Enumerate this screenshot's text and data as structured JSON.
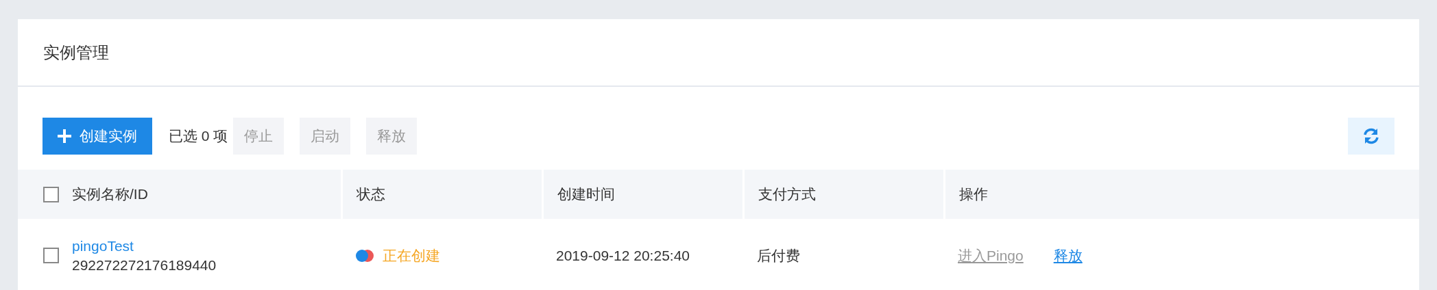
{
  "panel": {
    "title": "实例管理"
  },
  "toolbar": {
    "create_button": "创建实例",
    "selection_text": "已选 0 项",
    "batch_buttons": [
      {
        "label": "停止",
        "disabled": true
      },
      {
        "label": "启动",
        "disabled": true
      },
      {
        "label": "释放",
        "disabled": true
      }
    ]
  },
  "table": {
    "select_all": {
      "checked": false
    },
    "columns": [
      "实例名称/ID",
      "状态",
      "创建时间",
      "支付方式",
      "操作"
    ],
    "rows": [
      {
        "checked": false,
        "name": "pingoTest",
        "id": "292272272176189440",
        "status": {
          "label": "正在创建",
          "color": "#f5a623"
        },
        "created": "2019-09-12 20:25:40",
        "payment": "后付费",
        "actions": [
          {
            "label": "进入Pingo",
            "disabled": true
          },
          {
            "label": "释放",
            "disabled": false
          }
        ]
      }
    ]
  }
}
